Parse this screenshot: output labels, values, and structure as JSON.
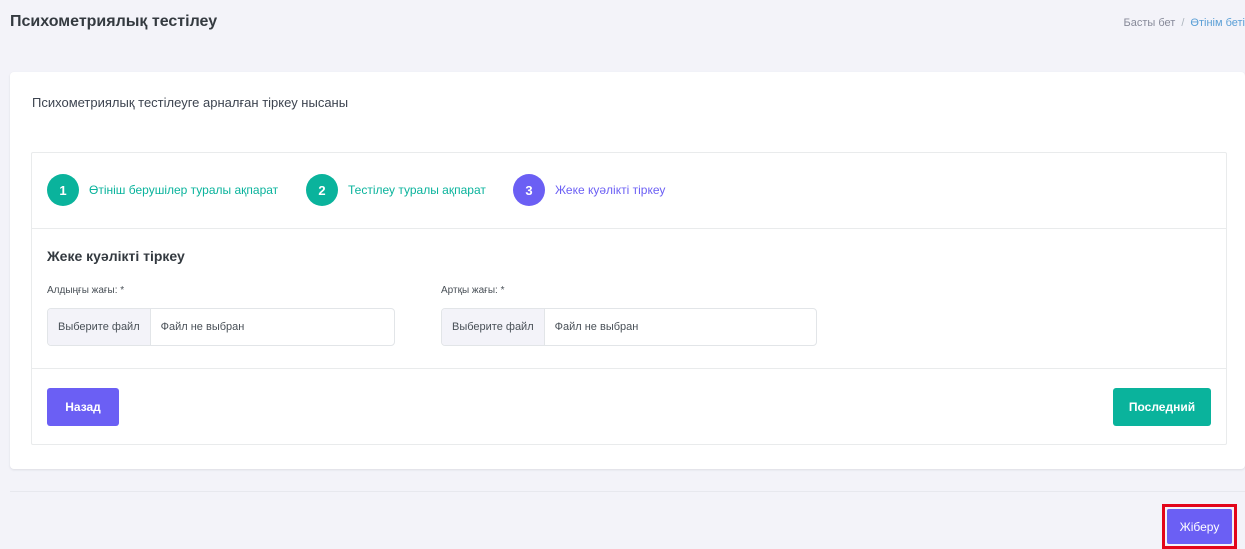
{
  "header": {
    "title": "Психометриялық тестілеу",
    "breadcrumb": [
      "Басты бет",
      "Өтінім беті"
    ]
  },
  "form": {
    "title": "Психометриялық тестілеуге арналған тіркеу нысаны",
    "steps": [
      {
        "number": "1",
        "label": "Өтініш берушілер туралы ақпарат",
        "status": "done"
      },
      {
        "number": "2",
        "label": "Тестілеу туралы ақпарат",
        "status": "done"
      },
      {
        "number": "3",
        "label": "Жеке куәлікті тіркеу",
        "status": "current"
      }
    ],
    "section_title": "Жеке куәлікті тіркеу",
    "front": {
      "label": "Алдыңғы жағы: *",
      "button": "Выберите файл",
      "value": "Файл не выбран"
    },
    "back": {
      "label": "Артқы жағы: *",
      "button": "Выберите файл",
      "value": "Файл не выбран"
    },
    "back_button": "Назад",
    "last_button": "Последний"
  },
  "submit_button": "Жіберу",
  "colors": {
    "accent": "#6b5ff4",
    "success": "#0ab39c",
    "highlight": "#e3061b",
    "background": "#f3f3f9"
  }
}
